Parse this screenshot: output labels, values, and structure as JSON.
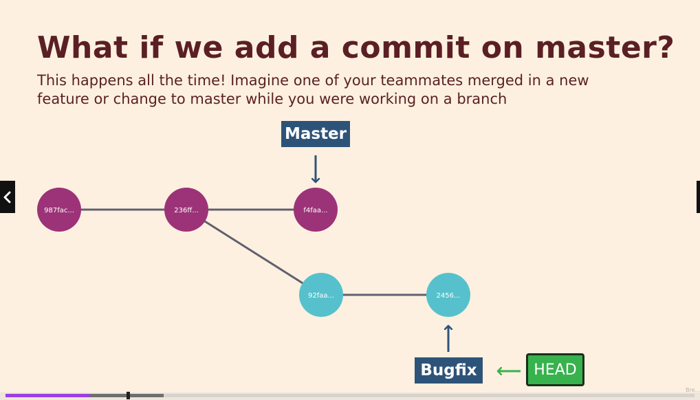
{
  "slide": {
    "title": "What if we add a commit on master?",
    "subtitle": "This happens all the time! Imagine one of your teammates merged in a new feature or change to master while you were working on a branch"
  },
  "commits": {
    "c1": "987fac...",
    "c2": "236ff...",
    "c3": "f4faa...",
    "c4": "92faa...",
    "c5": "2456..."
  },
  "labels": {
    "master": "Master",
    "bugfix": "Bugfix",
    "head": "HEAD"
  },
  "colors": {
    "background": "#fdf0e0",
    "title_text": "#5a1f24",
    "master_commit": "#9c3378",
    "branch_commit": "#56c1cc",
    "edge": "#5f5f6e",
    "branch_label": "#2e5379",
    "head_label": "#37b24d",
    "head_arrow": "#37b24d",
    "progress_played": "#9b3fe0"
  },
  "player": {
    "progress_fraction": 0.12,
    "buffered_fraction": 0.23,
    "watermark": "Bre..."
  },
  "icons": {
    "previous": "chevron-left-icon",
    "master_pointer": "arrow-down-icon",
    "bugfix_pointer": "arrow-up-icon",
    "head_pointer": "arrow-left-icon"
  }
}
